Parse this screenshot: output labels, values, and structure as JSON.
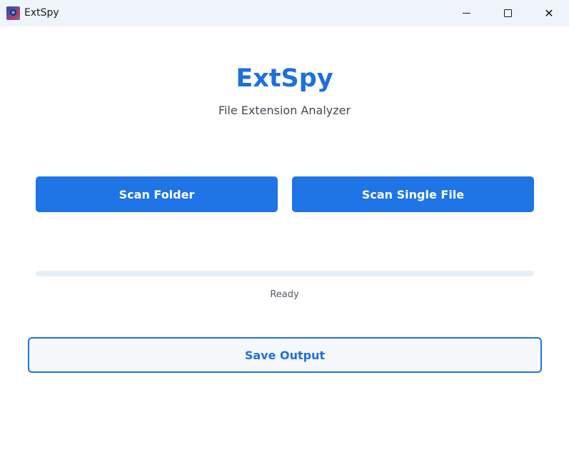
{
  "window": {
    "title": "ExtSpy",
    "app_icon": "extspy-app-icon",
    "controls": {
      "minimize_icon": "minimize-icon",
      "maximize_icon": "maximize-icon",
      "close_glyph": "✕"
    }
  },
  "header": {
    "title": "ExtSpy",
    "subtitle": "File Extension Analyzer"
  },
  "actions": {
    "scan_folder_label": "Scan Folder",
    "scan_file_label": "Scan Single File"
  },
  "progress": {
    "value_fraction": 0,
    "status": "Ready"
  },
  "footer": {
    "save_label": "Save Output"
  },
  "colors": {
    "accent": "#1f74e6",
    "title_text": "#1f6fde",
    "titlebar_bg": "#eef4f9",
    "progress_track": "#e6eef8"
  }
}
